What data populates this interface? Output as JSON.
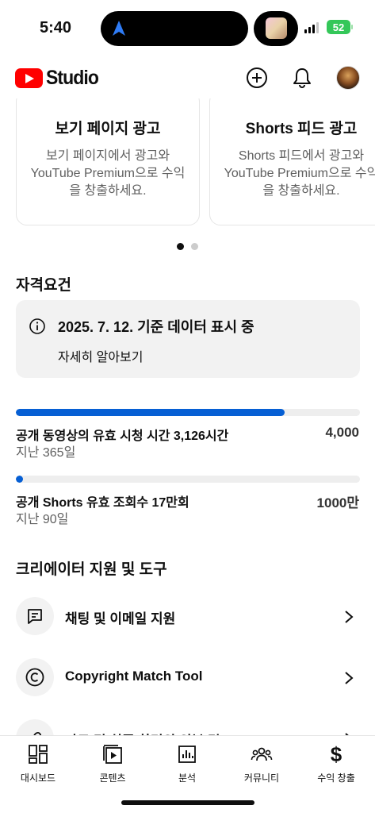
{
  "status_bar": {
    "time": "5:40",
    "battery": "52"
  },
  "header": {
    "logo_text": "Studio",
    "add_label": "create",
    "notifications_label": "notifications"
  },
  "ad_cards": [
    {
      "title": "보기 페이지 광고",
      "description": "보기 페이지에서 광고와\nYouTube Premium으로 수익\n을 창출하세요."
    },
    {
      "title": "Shorts 피드 광고",
      "description": "Shorts 피드에서 광고와\nYouTube Premium으로 수익\n을 창출하세요."
    }
  ],
  "eligibility": {
    "title": "자격요건",
    "info_text": "2025. 7. 12. 기준 데이터 표시 중",
    "info_link": "자세히 알아보기",
    "metrics": [
      {
        "label": "공개 동영상의 유효 시청 시간 3,126시간",
        "sub": "지난 365일",
        "target": "4,000",
        "progress": 0.78
      },
      {
        "label": "공개 Shorts 유효 조회수 17만회",
        "sub": "지난 90일",
        "target": "1000만",
        "progress": 0.017
      }
    ]
  },
  "tools": {
    "title": "크리에이터 지원 및 도구",
    "items": [
      {
        "label": "채팅 및 이메일 지원",
        "icon": "chat-icon"
      },
      {
        "label": "Copyright Match Tool",
        "icon": "copyright-icon"
      },
      {
        "label": "카드 및 최종 화면의 외부 링크",
        "icon": "link-icon"
      }
    ]
  },
  "bottom_nav": [
    {
      "label": "대시보드",
      "icon": "dashboard-icon"
    },
    {
      "label": "콘텐츠",
      "icon": "content-icon"
    },
    {
      "label": "분석",
      "icon": "analytics-icon"
    },
    {
      "label": "커뮤니티",
      "icon": "community-icon"
    },
    {
      "label": "수익 창출",
      "icon": "dollar-icon"
    }
  ],
  "colors": {
    "accent": "#065fd4",
    "brand_red": "#ff0000",
    "battery": "#34c759"
  }
}
